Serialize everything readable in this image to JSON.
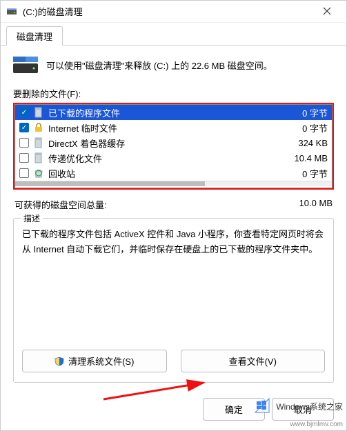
{
  "window": {
    "title": "(C:)的磁盘清理"
  },
  "tab": {
    "label": "磁盘清理"
  },
  "intro": {
    "text": "可以使用\"磁盘清理\"来释放 (C:) 上的 22.6 MB 磁盘空间。"
  },
  "filelist": {
    "label": "要删除的文件(F):",
    "items": [
      {
        "checked": true,
        "icon": "file-icon",
        "name": "已下载的程序文件",
        "size": "0 字节",
        "selected": true
      },
      {
        "checked": true,
        "icon": "lock-icon",
        "name": "Internet 临时文件",
        "size": "0 字节",
        "selected": false
      },
      {
        "checked": false,
        "icon": "file-icon",
        "name": "DirectX 着色器缓存",
        "size": "324 KB",
        "selected": false
      },
      {
        "checked": false,
        "icon": "file-icon",
        "name": "传递优化文件",
        "size": "10.4 MB",
        "selected": false
      },
      {
        "checked": false,
        "icon": "recycle-icon",
        "name": "回收站",
        "size": "0 字节",
        "selected": false
      }
    ]
  },
  "totals": {
    "label": "可获得的磁盘空间总量:",
    "value": "10.0 MB"
  },
  "description": {
    "legend": "描述",
    "text": "已下载的程序文件包括 ActiveX 控件和 Java 小程序，你查看特定网页时将会从 Internet 自动下载它们，并临时保存在硬盘上的已下载的程序文件夹中。"
  },
  "buttons": {
    "clean_system": "清理系统文件(S)",
    "view_files": "查看文件(V)",
    "ok": "确定",
    "cancel": "取消"
  },
  "watermark": {
    "brand": "Windows系统之家",
    "url": "www.bjmlmv.com"
  },
  "colors": {
    "selection": "#1a56d6",
    "highlight_border": "#e11",
    "checkbox_checked": "#0067c0"
  }
}
